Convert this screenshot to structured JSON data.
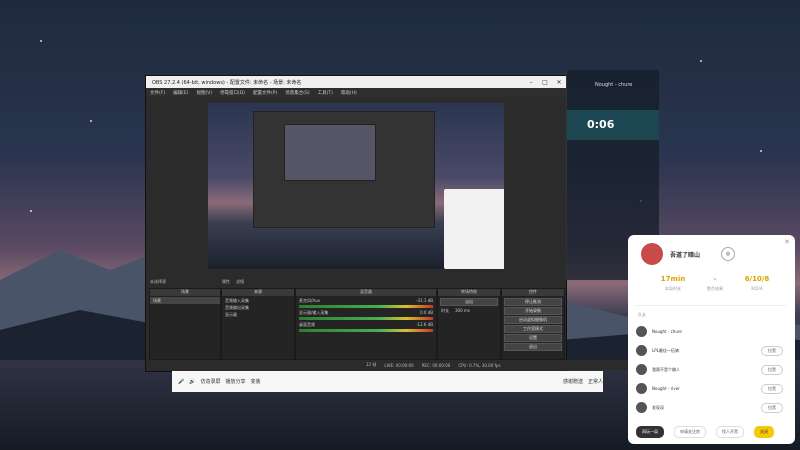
{
  "colors": {
    "accent": "#d9a400",
    "primary_button": "#f6c800"
  },
  "obs": {
    "title": "OBS 27.2.4 (64-bit, windows) - 配置文件: 未命名 - 场景: 未命名",
    "menus": [
      "文件(F)",
      "编辑(E)",
      "视图(V)",
      "停靠窗口(D)",
      "配置文件(P)",
      "场景集合(S)",
      "工具(T)",
      "帮助(H)"
    ],
    "scene_selector": "未选择源",
    "prop_btn": "属性",
    "filter_btn": "滤镜",
    "docks": {
      "scenes_header": "场景",
      "scenes": [
        "场景"
      ],
      "sources_header": "来源",
      "sources": [
        "音频输入采集",
        "音频输出采集",
        "显示器"
      ],
      "mixer_header": "混音器",
      "mixer": [
        {
          "name": "麦克风/Aux",
          "db": "-31.1 dB"
        },
        {
          "name": "显示器/输入采集",
          "db": "0.0 dB"
        },
        {
          "name": "桌面音频",
          "db": "-12.6 dB"
        }
      ],
      "transition_header": "转场特效",
      "transition_value": "淡出",
      "duration_label": "时长",
      "duration_value": "300 ms",
      "controls_header": "控件",
      "controls": [
        "停止推流",
        "开始录制",
        "启动虚拟摄像机",
        "工作室模式",
        "设置",
        "退出"
      ]
    },
    "status": {
      "live": "LIVE: 00:00:00",
      "rec": "REC: 00:00:00",
      "cpu": "CPU: 0.7%, 30.00 fps",
      "dropped": "12 帧"
    }
  },
  "side": {
    "title": "Nought - chure",
    "timer": "0:06"
  },
  "taskbar": {
    "items": [
      "仿造录屏",
      "播放分享",
      "变装",
      "感谢赠送",
      "正常人"
    ]
  },
  "popup": {
    "username": "吾道了暗山",
    "stats": [
      {
        "value": "17min",
        "label": "本局时长"
      },
      {
        "value": "-",
        "label": "胜负结果"
      },
      {
        "value": "6/10/8",
        "label": "K/D/A"
      }
    ],
    "section": "队友",
    "players": [
      {
        "name": "Nought - chure",
        "button": ""
      },
      {
        "name": "LPL最佳一伍骑",
        "button": "拉黑"
      },
      {
        "name": "我腐不是个输人",
        "button": "拉黑"
      },
      {
        "name": "Nought - river",
        "button": "拉黑"
      },
      {
        "name": "发现深",
        "button": "拉黑"
      }
    ],
    "footer": [
      "再玩一局",
      "申请关注房",
      "找人开黑",
      "关闭"
    ]
  }
}
